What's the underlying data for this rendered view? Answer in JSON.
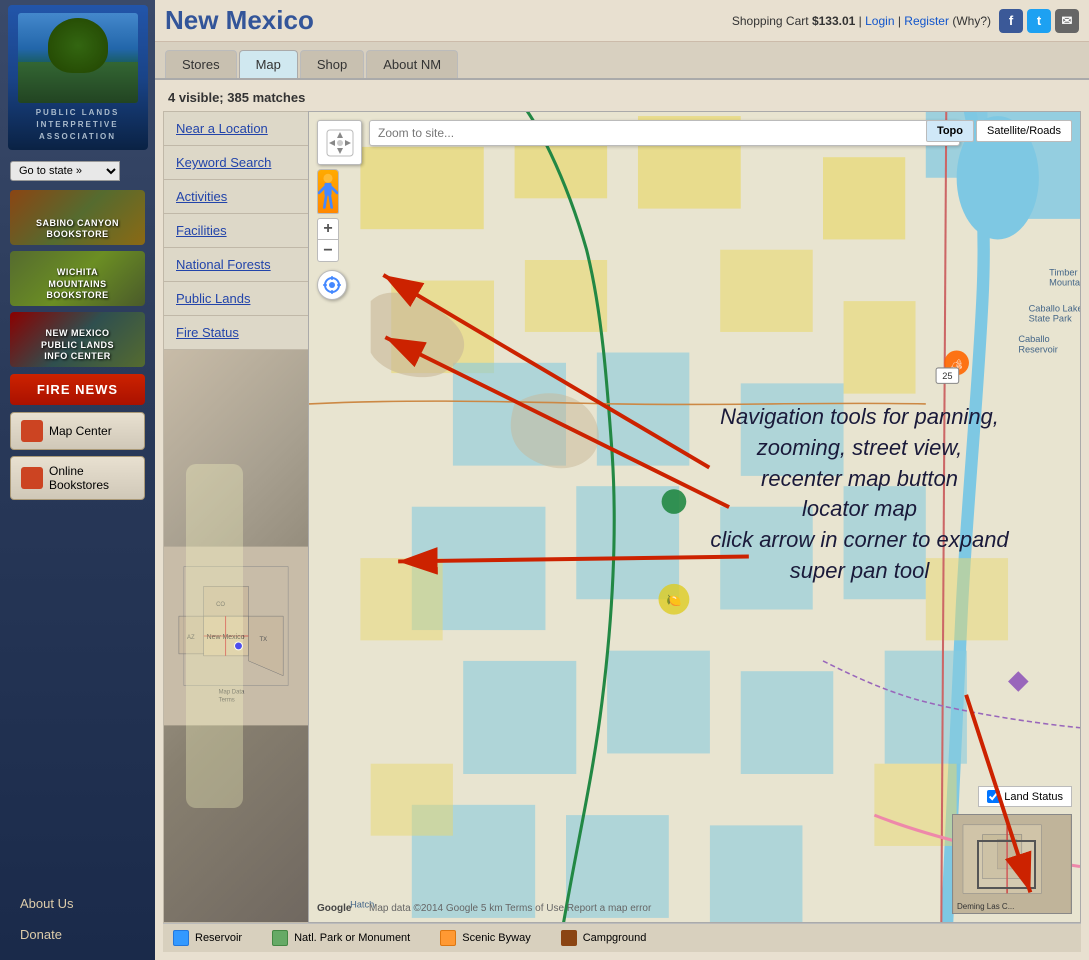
{
  "sidebar": {
    "logo_text": "PUBLIC LANDS\nINTERPRETIVE\nASSOCIATION",
    "state_selector_label": "Go to state »",
    "bookstores": [
      {
        "label": "SABINO CANYON\nBOOKSTORE",
        "bg": "1"
      },
      {
        "label": "WICHITA\nMOUNTAINS\nBOOKSTORE",
        "bg": "2"
      },
      {
        "label": "NEW MEXICO\nPUBLIC LANDS\nINFO CENTER",
        "bg": "3"
      }
    ],
    "fire_news_label": "FIRE NEWS",
    "nav_items": [
      {
        "label": "Map Center"
      },
      {
        "label": "Online Bookstores"
      }
    ],
    "links": [
      {
        "label": "About Us"
      },
      {
        "label": "Donate"
      }
    ]
  },
  "header": {
    "title": "New Mexico",
    "cart_label": "Shopping Cart",
    "cart_amount": "$133.01",
    "login_label": "Login",
    "register_label": "Register",
    "register_why": "(Why?)"
  },
  "tabs": [
    {
      "label": "Stores",
      "active": false
    },
    {
      "label": "Map",
      "active": true
    },
    {
      "label": "Shop",
      "active": false
    },
    {
      "label": "About NM",
      "active": false
    }
  ],
  "map": {
    "stats_visible": "4 visible;",
    "stats_matches": "385 matches",
    "nav_items": [
      {
        "label": "Near a Location"
      },
      {
        "label": "Keyword Search"
      },
      {
        "label": "Activities"
      },
      {
        "label": "Facilities"
      },
      {
        "label": "National Forests"
      },
      {
        "label": "Public Lands"
      },
      {
        "label": "Fire Status"
      }
    ],
    "zoom_to_site_placeholder": "Zoom to site...",
    "map_type_buttons": [
      {
        "label": "Topo",
        "active": true
      },
      {
        "label": "Satellite/Roads",
        "active": false
      }
    ],
    "zoom_plus": "+",
    "zoom_minus": "−",
    "annotation": "Navigation tools for panning,\nzooming, street view,\nrecenter map button\nlocator map\nclick arrow in corner to expand\nsuper pan tool",
    "land_status_label": "Land Status",
    "overview_label": "Deming   Las C...",
    "attribution": "Google",
    "map_data": "Map data ©2014 Google   5 km   Terms of Use   Report a map error"
  },
  "legend": [
    {
      "label": "Reservoir",
      "type": "reservoir"
    },
    {
      "label": "Natl. Park or Monument",
      "type": "natl"
    },
    {
      "label": "Scenic Byway",
      "type": "scenic"
    },
    {
      "label": "Campground",
      "type": "campground"
    }
  ]
}
